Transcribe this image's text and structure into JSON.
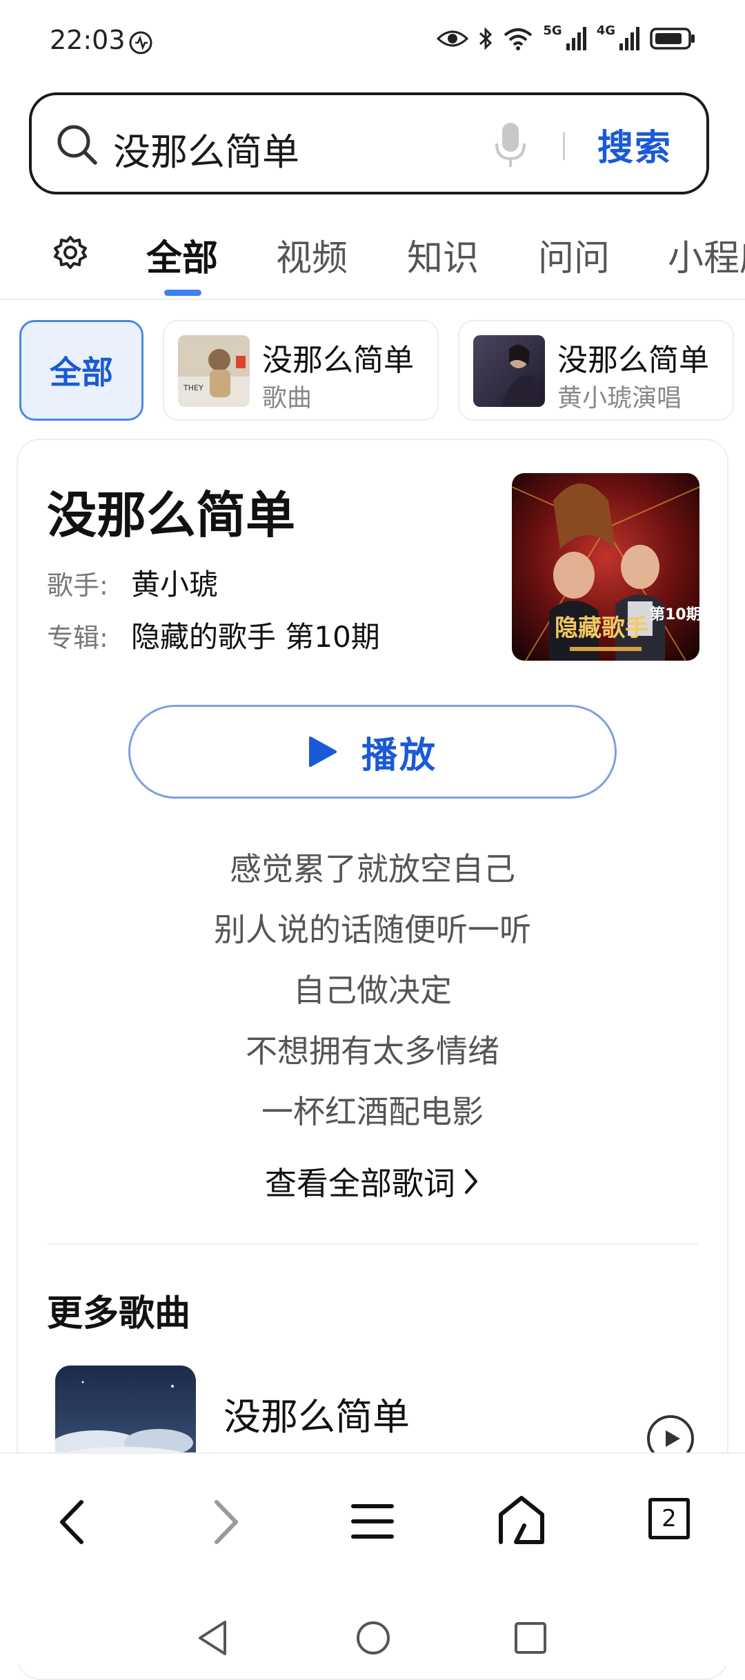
{
  "status_bar": {
    "time": "22:03",
    "network_1": "5G",
    "network_2": "4G"
  },
  "search": {
    "query": "没那么简单",
    "button_label": "搜索"
  },
  "tabs": [
    "全部",
    "视频",
    "知识",
    "问问",
    "小程序"
  ],
  "chips": {
    "all_label": "全部",
    "items": [
      {
        "title": "没那么简单",
        "subtitle": "歌曲"
      },
      {
        "title": "没那么简单",
        "subtitle": "黄小琥演唱"
      }
    ]
  },
  "song": {
    "title": "没那么简单",
    "singer_label": "歌手:",
    "singer": "黄小琥",
    "album_label": "专辑:",
    "album": "隐藏的歌手 第10期",
    "cover_text": "第10期",
    "cover_caption": "隐藏歌手",
    "play_label": "播放",
    "lyrics": [
      "感觉累了就放空自己",
      "别人说的话随便听一听",
      "自己做决定",
      "不想拥有太多情绪",
      "一杯红酒配电影"
    ],
    "view_all_lyrics": "查看全部歌词"
  },
  "more_songs": {
    "title": "更多歌曲",
    "items": [
      {
        "title": "没那么简单"
      }
    ]
  },
  "bottom_nav": {
    "tab_count": "2"
  },
  "colors": {
    "accent": "#1a5ad6",
    "indicator": "#3c82f6",
    "chip_bg": "#eaf1fd"
  }
}
